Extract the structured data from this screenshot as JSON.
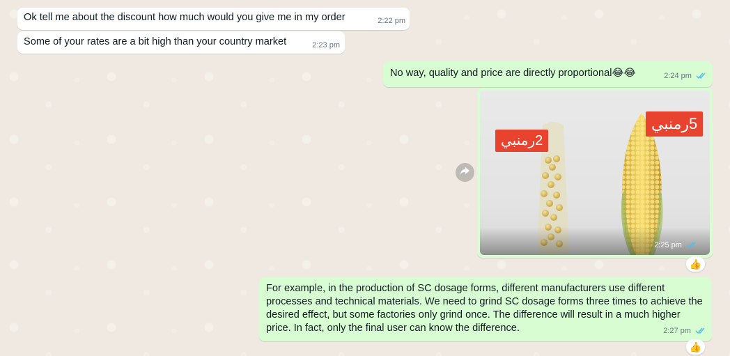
{
  "chat": {
    "messages": [
      {
        "text": "Ok tell me about the discount how much would you give me in my order",
        "time": "2:22 pm"
      },
      {
        "text": "Some of your rates are a bit high than your country market",
        "time": "2:23 pm"
      },
      {
        "text": "No way, quality and price are directly proportional😂😂",
        "time": "2:24 pm"
      },
      {
        "image": {
          "tag_left": "2رمنبي",
          "tag_right": "5رمنبي"
        },
        "time": "2:25 pm"
      },
      {
        "text": "For example, in the production of SC dosage forms, different manufacturers use different processes and technical materials. We need to grind SC dosage forms three times to achieve the desired effect, but some factories only grind once. The difference will result in a much higher price. In fact, only the final user can know the difference.",
        "time": "2:27 pm"
      }
    ],
    "reactions": [
      "👍",
      "👍"
    ],
    "colors": {
      "incoming": "#ffffff",
      "outgoing": "#d9fdd3",
      "read_ticks": "#53bdeb",
      "wallpaper": "#efe9e1"
    },
    "icons": {
      "forward": "forward-icon",
      "read": "double-check-icon"
    }
  }
}
